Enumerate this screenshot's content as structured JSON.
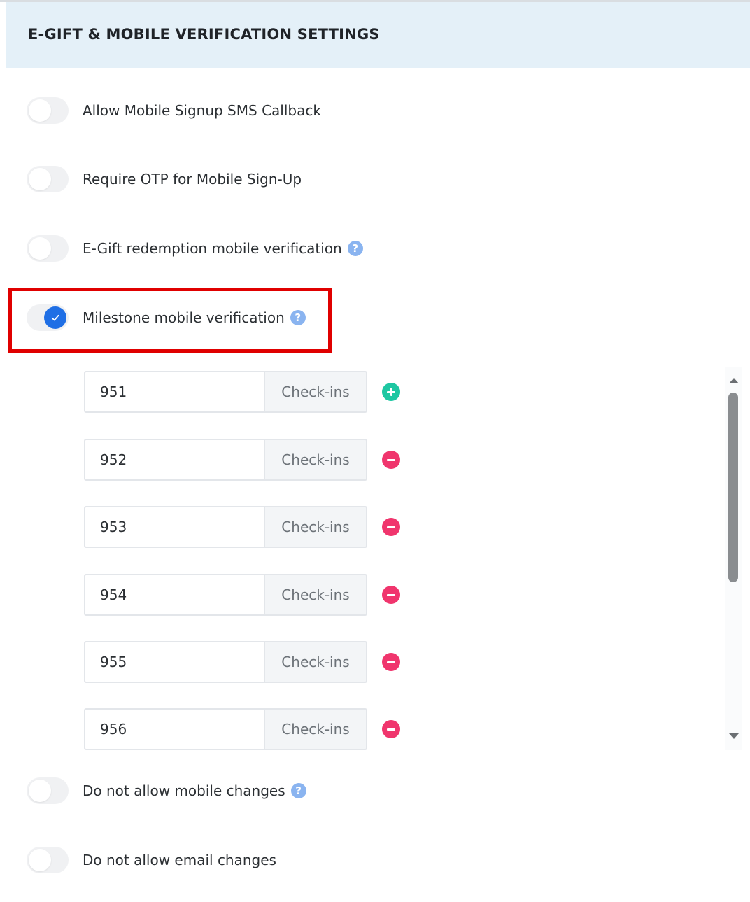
{
  "header": {
    "title": "E-GIFT & MOBILE VERIFICATION SETTINGS"
  },
  "settings": [
    {
      "label": "Allow Mobile Signup SMS Callback",
      "enabled": false,
      "help": false
    },
    {
      "label": "Require OTP for Mobile Sign-Up",
      "enabled": false,
      "help": false
    },
    {
      "label": "E-Gift redemption mobile verification",
      "enabled": false,
      "help": true
    },
    {
      "label": "Milestone mobile verification",
      "enabled": true,
      "help": true
    },
    {
      "label": "Do not allow mobile changes",
      "enabled": false,
      "help": true
    },
    {
      "label": "Do not allow email changes",
      "enabled": false,
      "help": false
    }
  ],
  "help_icon_glyph": "?",
  "milestones": [
    {
      "value": "951",
      "unit": "Check-ins",
      "action": "add"
    },
    {
      "value": "952",
      "unit": "Check-ins",
      "action": "remove"
    },
    {
      "value": "953",
      "unit": "Check-ins",
      "action": "remove"
    },
    {
      "value": "954",
      "unit": "Check-ins",
      "action": "remove"
    },
    {
      "value": "955",
      "unit": "Check-ins",
      "action": "remove"
    },
    {
      "value": "956",
      "unit": "Check-ins",
      "action": "remove"
    }
  ],
  "colors": {
    "header_bg": "#e4f0f8",
    "toggle_on": "#1f6fe5",
    "toggle_off": "#f0f1f3",
    "add_button": "#1ec7a2",
    "remove_button": "#f0356d",
    "highlight": "#e00000",
    "help_icon": "#8ab4f0"
  }
}
